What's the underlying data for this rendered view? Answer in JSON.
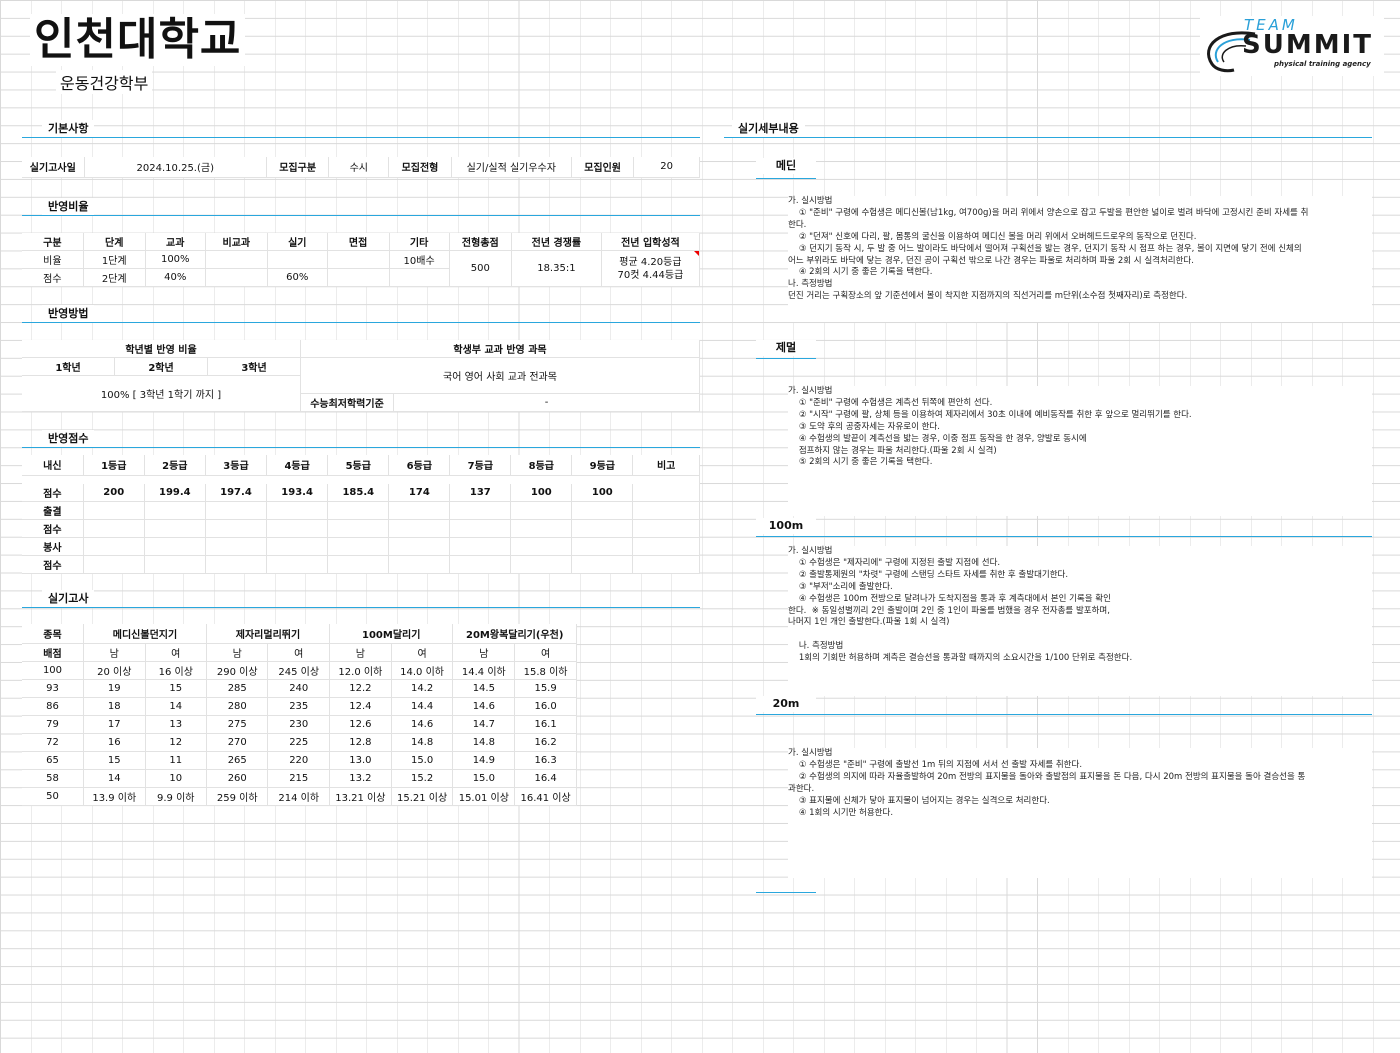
{
  "header": {
    "title": "인천대학교",
    "subtitle": "운동건강학부"
  },
  "logo": {
    "team": "TEAM",
    "summit": "SUMMIT",
    "tagline": "physical training agency"
  },
  "sections": {
    "basic": "기본사항",
    "ratio": "반영비율",
    "method": "반영방법",
    "score": "반영점수",
    "practical": "실기고사",
    "detail": "실기세부내용"
  },
  "basic": {
    "exam_date_label": "실기고사일",
    "exam_date": "2024.10.25.(금)",
    "category_label": "모집구분",
    "category": "수시",
    "type_label": "모집전형",
    "type": "실기/실적 실기우수자",
    "count_label": "모집인원",
    "count": "20"
  },
  "ratio_table": {
    "headers": [
      "구분",
      "단계",
      "교과",
      "비교과",
      "실기",
      "면접",
      "기타",
      "전형총점",
      "전년 경쟁률",
      "전년 입학성적"
    ],
    "row1": {
      "label": "비율",
      "stage": "1단계",
      "subject": "100%",
      "etc": "10배수"
    },
    "row2": {
      "label": "점수",
      "stage": "2단계",
      "subject": "40%",
      "practical": "60%"
    },
    "total": "500",
    "competition": "18.35:1",
    "grade_line1": "평균 4.20등급",
    "grade_line2": "70컷 4.44등급"
  },
  "method_table": {
    "year_ratio_title": "학년별 반영 비율",
    "years": [
      "1학년",
      "2학년",
      "3학년"
    ],
    "year_ratio_value": "100% [ 3학년 1학기 까지 ]",
    "subject_title": "학생부 교과 반영 과목",
    "subject_value": "국어 영어 사회 교과 전과목",
    "min_label": "수능최저학력기준",
    "min_value": "-"
  },
  "score_table": {
    "headers": [
      "내신",
      "1등급",
      "2등급",
      "3등급",
      "4등급",
      "5등급",
      "6등급",
      "7등급",
      "8등급",
      "9등급",
      "비고"
    ],
    "score_label": "점수",
    "scores": [
      "200",
      "199.4",
      "197.4",
      "193.4",
      "185.4",
      "174",
      "137",
      "100",
      "100"
    ],
    "extra_labels": [
      "출결",
      "점수",
      "봉사",
      "점수"
    ]
  },
  "practical_table": {
    "col_label": "종목",
    "events": [
      "메디신볼던지기",
      "제자리멀리뛰기",
      "100M달리기",
      "20M왕복달리기(우천)"
    ],
    "points_label": "배점",
    "genders": [
      "남",
      "여",
      "남",
      "여",
      "남",
      "여",
      "남",
      "여"
    ],
    "rows": [
      [
        "100",
        "20 이상",
        "16 이상",
        "290 이상",
        "245 이상",
        "12.0 이하",
        "14.0 이하",
        "14.4 이하",
        "15.8 이하"
      ],
      [
        "93",
        "19",
        "15",
        "285",
        "240",
        "12.2",
        "14.2",
        "14.5",
        "15.9"
      ],
      [
        "86",
        "18",
        "14",
        "280",
        "235",
        "12.4",
        "14.4",
        "14.6",
        "16.0"
      ],
      [
        "79",
        "17",
        "13",
        "275",
        "230",
        "12.6",
        "14.6",
        "14.7",
        "16.1"
      ],
      [
        "72",
        "16",
        "12",
        "270",
        "225",
        "12.8",
        "14.8",
        "14.8",
        "16.2"
      ],
      [
        "65",
        "15",
        "11",
        "265",
        "220",
        "13.0",
        "15.0",
        "14.9",
        "16.3"
      ],
      [
        "58",
        "14",
        "10",
        "260",
        "215",
        "13.2",
        "15.2",
        "15.0",
        "16.4"
      ],
      [
        "50",
        "13.9 이하",
        "9.9 이하",
        "259 이하",
        "214 이하",
        "13.21 이상",
        "15.21 이상",
        "15.01 이상",
        "16.41 이상"
      ]
    ]
  },
  "details": {
    "medi": {
      "title": "메딘",
      "text": "가. 실시방법\n    ① \"준비\" 구령에 수험생은 메디신볼(남1kg, 여700g)을 머리 위에서 양손으로 잡고 두발을 편안한 넓이로 벌려 바닥에 고정시킨 준비 자세를 취\n한다.\n    ② \"던져\" 신호에 다리, 팔, 몸통의 굴신을 이용하여 메디신 볼을 머리 위에서 오버헤드드로우의 동작으로 던진다.\n    ③ 던지기 동작 시, 두 발 중 어느 발이라도 바닥에서 떨어져 구획선을 밟는 경우, 던지기 동작 시 점프 하는 경우, 볼이 지면에 닿기 전에 신체의\n어느 부위라도 바닥에 닿는 경우, 던진 공이 구획선 밖으로 나간 경우는 파울로 처리하며 파울 2회 시 실격처리한다.\n    ④ 2회의 시기 중 좋은 기록을 택한다.\n나. 측정방법\n던진 거리는 구획장소의 앞 기준선에서 볼이 착지한 지점까지의 직선거리를 m단위(소수점 첫째자리)로 측정한다."
    },
    "jump": {
      "title": "제멀",
      "text": "가. 실시방법\n    ① \"준비\" 구령에 수험생은 계측선 뒤쪽에 편안히 선다.\n    ② \"시작\" 구령에 팔, 상체 등을 이용하여 제자리에서 30초 이내에 예비동작를 취한 후 앞으로 멀리뛰기를 한다.\n    ③ 도약 후의 공중자세는 자유로이 한다.\n    ④ 수험생의 발끝이 계측선을 밟는 경우, 이중 점프 동작을 한 경우, 양발로 동시에\n    점프하지 않는 경우는 파울 처리한다.(파울 2회 시 실격)\n    ⑤ 2회의 시기 중 좋은 기록을 택한다."
    },
    "run100": {
      "title": "100m",
      "text": "가. 실시방법\n    ① 수험생은 \"제자리에\" 구령에 지정된 출발 지점에 선다.\n    ② 출발통제원의 \"차렷\" 구령에 스탠딩 스타트 자세를 취한 후 출발대기한다.\n    ③ \"부저\"소리에 출발한다.\n    ④ 수험생은 100m 전방으로 달려나가 도착지점을 통과 후 계측대에서 본인 기록을 확인\n한다.  ※ 동일성별끼리 2인 출발이며 2인 중 1인이 파울를 범했을 경우 전자총를 발포하며,\n나머지 1인 개인 출발한다.(파울 1회 시 실격)\n\n    나. 측정방법\n    1회의 기회만 허용하며 계측은 결승선을 통과할 때까지의 소요시간을 1/100 단위로 측정한다."
    },
    "shuttle": {
      "title": "20m",
      "text": "가. 실시방법\n    ① 수험생은 \"준비\" 구령에 출발선 1m 뒤의 지점에 서서 선 출발 자세를 취한다.\n    ② 수험생의 의지에 따라 자율출발하여 20m 전방의 표지물을 돌아와 출발점의 표지물을 돈 다음, 다시 20m 전방의 표지물을 돌아 결승선을 통\n과한다.\n    ③ 표지물에 신체가 닿아 표지물이 넘어지는 경우는 실격으로 처리한다.\n    ④ 1회의 시기만 허용한다."
    }
  }
}
